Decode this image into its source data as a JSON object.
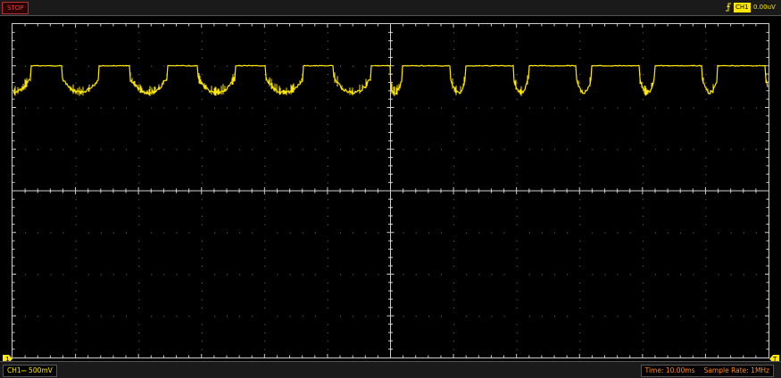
{
  "status": {
    "run_state": "STOP"
  },
  "trigger": {
    "edge_icon": "rising-edge-icon",
    "channel": "CH1",
    "level": "0.00uV"
  },
  "channel": {
    "label": "CH1",
    "coupling_symbol": "⎓",
    "volts_per_div": "500mV",
    "marker": "1",
    "color": "#ffe800"
  },
  "timebase": {
    "time_label": "Time: 10.00ms",
    "sample_rate_label": "Sample Rate: 1MHz",
    "trigger_marker": "T"
  },
  "waveform": {
    "grid_divisions": {
      "x": 12,
      "y": 8
    },
    "high_level_div": 1.0,
    "dip_depth_div": 0.65,
    "left_group": {
      "period_div": 1.08,
      "dip_fraction": 0.55
    },
    "right_group": {
      "period_div": 1.0,
      "dip_fraction": 0.24
    }
  },
  "colors": {
    "trace": "#ffe800",
    "grid": "#cfcfcf",
    "text_orange": "#ff8a18",
    "stop_red": "#ff3a3a"
  }
}
